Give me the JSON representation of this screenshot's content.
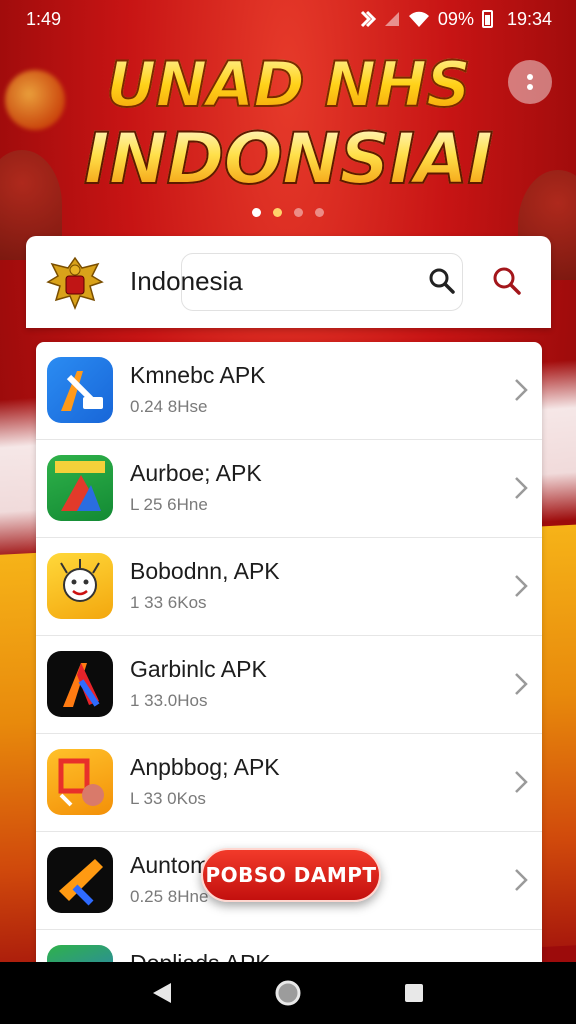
{
  "status_bar": {
    "time": "1:49",
    "battery_percent": "09%",
    "clock_right": "19:34",
    "icons": [
      "nfc-icon",
      "signal-icon",
      "wifi-icon",
      "battery-icon"
    ]
  },
  "banner": {
    "title_line1": "UNAD NHS",
    "title_line2": "INDONSIAI",
    "page_count": 4,
    "active_page": 1
  },
  "header": {
    "search_label": "Indonesia",
    "emblem": "garuda-emblem"
  },
  "apps": [
    {
      "name": "Kmnebc APK",
      "meta": "0.24 8Hse",
      "icon": "app-icon-blue"
    },
    {
      "name": "Aurboe; APK",
      "meta": "L 25 6Hne",
      "icon": "app-icon-green"
    },
    {
      "name": "Bobodnn, APK",
      "meta": "1 33 6Kos",
      "icon": "app-icon-yellow-face"
    },
    {
      "name": "Garbinlc APK",
      "meta": "1 33.0Hos",
      "icon": "app-icon-black-red"
    },
    {
      "name": "Anpbbog; APK",
      "meta": "L 33 0Kos",
      "icon": "app-icon-orange"
    },
    {
      "name": "Auntom",
      "meta": "0.25 8Hne",
      "icon": "app-icon-black-orange"
    },
    {
      "name": "Dopliads APK",
      "meta": "",
      "icon": "app-icon-partial"
    }
  ],
  "fab": {
    "label": "POBSO DAMPT"
  },
  "nav": {
    "back": "back-icon",
    "home": "home-icon",
    "recents": "recents-icon"
  },
  "colors": {
    "primary_red": "#c3100e",
    "gold": "#ffd21a"
  }
}
